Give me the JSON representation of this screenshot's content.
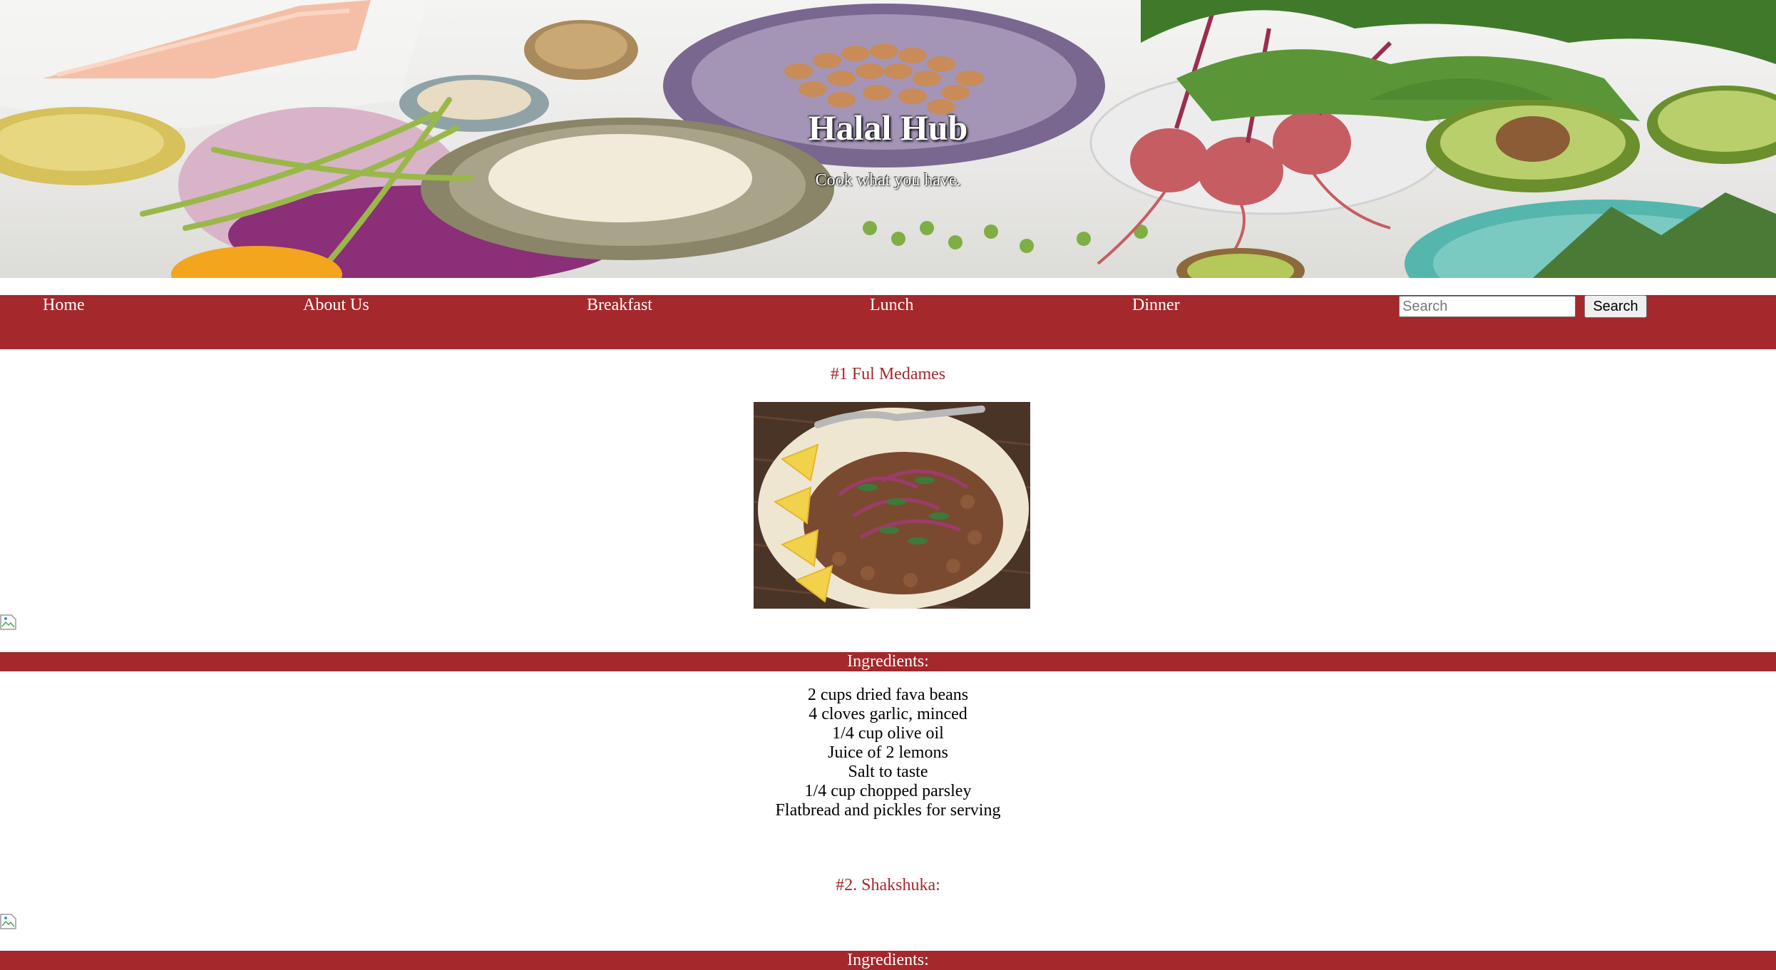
{
  "hero": {
    "title": "Halal Hub",
    "tagline": "Cook what you have."
  },
  "nav": {
    "items": [
      {
        "label": "Home"
      },
      {
        "label": "About Us"
      },
      {
        "label": "Breakfast"
      },
      {
        "label": "Lunch"
      },
      {
        "label": "Dinner"
      }
    ],
    "search_placeholder": "Search",
    "search_button": "Search"
  },
  "recipes": [
    {
      "title": "#1 Ful Medames",
      "ingredients_label": "Ingredients:",
      "ingredients": [
        "2 cups dried fava beans",
        "4 cloves garlic, minced",
        "1/4 cup olive oil",
        "Juice of 2 lemons",
        "Salt to taste",
        "1/4 cup chopped parsley",
        "Flatbread and pickles for serving"
      ]
    },
    {
      "title": "#2. Shakshuka:",
      "ingredients_label": "Ingredients:"
    }
  ],
  "colors": {
    "brand_red": "#a4282c",
    "white": "#ffffff"
  }
}
